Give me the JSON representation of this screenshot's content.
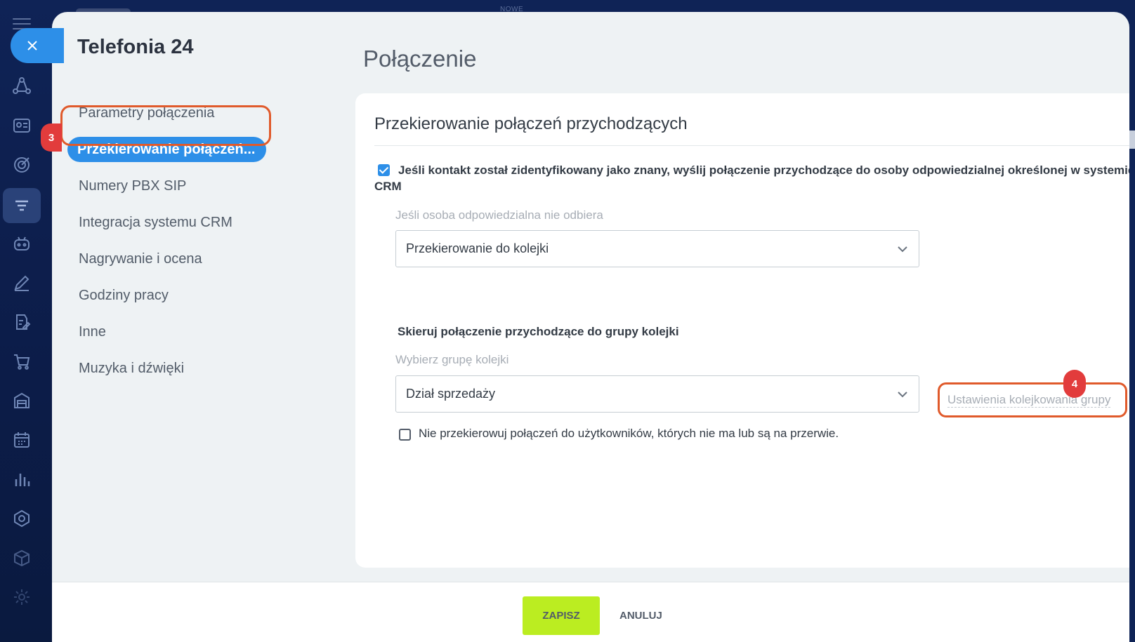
{
  "app": {
    "top_label": "NOWE"
  },
  "modal": {
    "title": "Telefonia 24",
    "section_title": "Połączenie"
  },
  "nav": {
    "items": [
      {
        "label": "Parametry połączenia",
        "active": false
      },
      {
        "label": "Przekierowanie połączeń...",
        "active": true
      },
      {
        "label": "Numery PBX SIP",
        "active": false
      },
      {
        "label": "Integracja systemu CRM",
        "active": false
      },
      {
        "label": "Nagrywanie i ocena",
        "active": false
      },
      {
        "label": "Godziny pracy",
        "active": false
      },
      {
        "label": "Inne",
        "active": false
      },
      {
        "label": "Muzyka i dźwięki",
        "active": false
      }
    ]
  },
  "callouts": {
    "nav_badge": "3",
    "queue_badge": "4"
  },
  "card": {
    "title": "Przekierowanie połączeń przychodzących",
    "crm_checkbox": {
      "checked": true,
      "label": "Jeśli kontakt został zidentyfikowany jako znany, wyślij połączenie przychodzące do osoby odpowiedzialnej określonej w systemie CRM"
    },
    "no_answer": {
      "label": "Jeśli osoba odpowiedzialna nie odbiera",
      "value": "Przekierowanie do kolejki"
    },
    "queue_section_title": "Skieruj połączenie przychodzące do grupy kolejki",
    "queue_group": {
      "label": "Wybierz grupę kolejki",
      "value": "Dział sprzedaży"
    },
    "queue_settings_link": "Ustawienia kolejkowania grupy",
    "skip_checkbox": {
      "checked": false,
      "label": "Nie przekierowuj połączeń do użytkowników, których nie ma lub są na przerwie."
    }
  },
  "footer": {
    "save_label": "ZAPISZ",
    "cancel_label": "ANULUJ"
  },
  "colors": {
    "accent_blue": "#2d8fe8",
    "save_green": "#bbed21",
    "callout_orange": "#e05a2b",
    "badge_red": "#e23c3c"
  },
  "icons": {
    "rail": [
      "hamburger-icon",
      "close-icon",
      "flow-icon",
      "contact-card-icon",
      "target-icon",
      "filter-icon",
      "robot-icon",
      "pen-icon",
      "document-edit-icon",
      "cart-icon",
      "warehouse-icon",
      "calendar-icon",
      "bar-chart-icon",
      "hexagon-icon",
      "box-icon",
      "gear-icon"
    ]
  }
}
